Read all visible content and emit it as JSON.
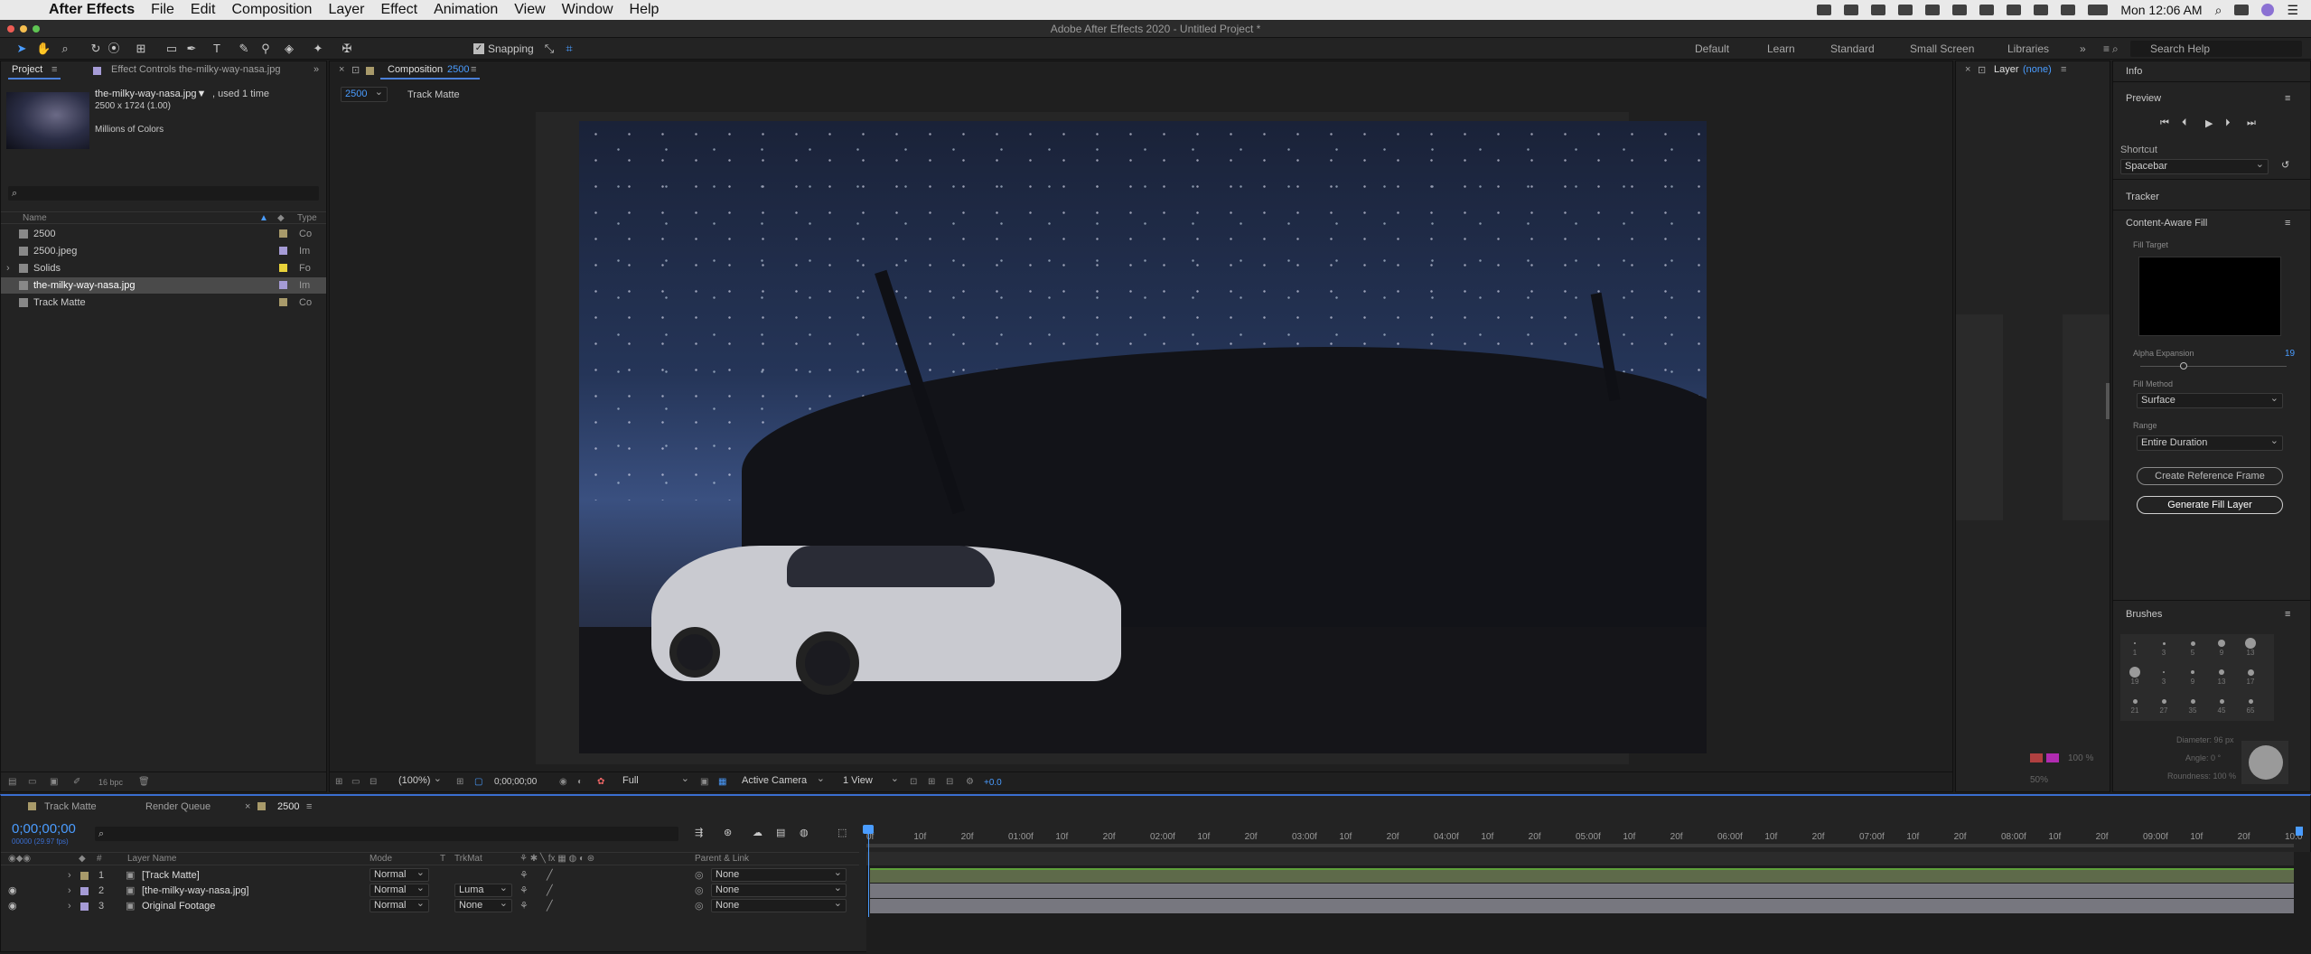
{
  "menubar": {
    "app_name": "After Effects",
    "items": [
      "File",
      "Edit",
      "Composition",
      "Layer",
      "Effect",
      "Animation",
      "View",
      "Window",
      "Help"
    ],
    "clock": "Mon 12:06 AM"
  },
  "window_title": "Adobe After Effects 2020 - Untitled Project *",
  "toolbar": {
    "snapping_label": "Snapping",
    "workspaces": [
      "Default",
      "Learn",
      "Standard",
      "Small Screen",
      "Libraries"
    ],
    "search_placeholder": "Search Help"
  },
  "project_panel": {
    "tab_project": "Project",
    "tab_effect_controls": "Effect Controls the-milky-way-nasa.jpg",
    "selected_name": "the-milky-way-nasa.jpg▼",
    "selected_usage": ", used 1 time",
    "selected_dims": "2500 x 1724 (1.00)",
    "selected_colors": "Millions of Colors",
    "col_name": "Name",
    "col_type": "Type",
    "items": [
      {
        "name": "2500",
        "type": "Co",
        "color": "#a89a6a"
      },
      {
        "name": "2500.jpeg",
        "type": "Im",
        "color": "#a59bd6"
      },
      {
        "name": "Solids",
        "type": "Fo",
        "color": "#e8d23a"
      },
      {
        "name": "the-milky-way-nasa.jpg",
        "type": "Im",
        "color": "#a59bd6"
      },
      {
        "name": "Track Matte",
        "type": "Co",
        "color": "#a89a6a"
      }
    ],
    "bpc": "16 bpc"
  },
  "comp_panel": {
    "tab_label": "Composition",
    "tab_comp_name": "2500",
    "crumb_active": "2500",
    "crumb_other": "Track Matte",
    "zoom": "(100%)",
    "timecode": "0;00;00;00",
    "resolution": "Full",
    "camera": "Active Camera",
    "views": "1 View",
    "exposure": "+0.0"
  },
  "layer_panel": {
    "tab_label": "Layer",
    "tab_value": "(none)",
    "zoom": "50%",
    "opacity": "100 %"
  },
  "right_panel": {
    "info": "Info",
    "preview": "Preview",
    "shortcut_label": "Shortcut",
    "shortcut_value": "Spacebar",
    "tracker": "Tracker",
    "caf_title": "Content-Aware Fill",
    "fill_target": "Fill Target",
    "alpha_expansion_label": "Alpha Expansion",
    "alpha_expansion_value": "19",
    "fill_method_label": "Fill Method",
    "fill_method_value": "Surface",
    "range_label": "Range",
    "range_value": "Entire Duration",
    "create_ref_button": "Create Reference Frame",
    "generate_button": "Generate Fill Layer",
    "brushes_title": "Brushes",
    "brush_sizes": [
      "1",
      "3",
      "5",
      "9",
      "13",
      "19",
      "3",
      "9",
      "13",
      "17",
      "21",
      "27",
      "35",
      "45",
      "65"
    ],
    "diameter": "Diameter: 96 px",
    "angle": "Angle: 0 °",
    "roundness": "Roundness: 100 %"
  },
  "timeline": {
    "tabs": [
      "Track Matte",
      "Render Queue",
      "2500"
    ],
    "timecode": "0;00;00;00",
    "fps": "00000 (29.97 fps)",
    "col_layer_name": "Layer Name",
    "col_mode": "Mode",
    "col_t": "T",
    "col_trkmat": "TrkMat",
    "col_parent": "Parent & Link",
    "ruler": [
      "0f",
      "10f",
      "20f",
      "01:00f",
      "10f",
      "20f",
      "02:00f",
      "10f",
      "20f",
      "03:00f",
      "10f",
      "20f",
      "04:00f",
      "10f",
      "20f",
      "05:00f",
      "10f",
      "20f",
      "06:00f",
      "10f",
      "20f",
      "07:00f",
      "10f",
      "20f",
      "08:00f",
      "10f",
      "20f",
      "09:00f",
      "10f",
      "20f",
      "10:0"
    ],
    "layers": [
      {
        "num": "1",
        "name": "[Track Matte]",
        "mode": "Normal",
        "trkmat": "",
        "parent": "None",
        "color": "#a89a6a"
      },
      {
        "num": "2",
        "name": "[the-milky-way-nasa.jpg]",
        "mode": "Normal",
        "trkmat": "Luma",
        "parent": "None",
        "color": "#a59bd6"
      },
      {
        "num": "3",
        "name": "Original Footage",
        "mode": "Normal",
        "trkmat": "None",
        "parent": "None",
        "color": "#a59bd6"
      }
    ]
  }
}
